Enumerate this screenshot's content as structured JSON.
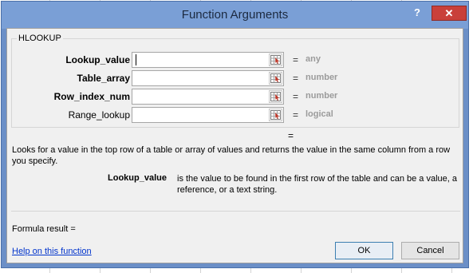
{
  "window": {
    "title": "Function Arguments",
    "help_glyph": "?",
    "close_glyph": "✕"
  },
  "function_name": "HLOOKUP",
  "arguments": [
    {
      "label": "Lookup_value",
      "value": "",
      "hint": "any",
      "bold": true
    },
    {
      "label": "Table_array",
      "value": "",
      "hint": "number",
      "bold": true
    },
    {
      "label": "Row_index_num",
      "value": "",
      "hint": "number",
      "bold": true
    },
    {
      "label": "Range_lookup",
      "value": "",
      "hint": "logical",
      "bold": false
    }
  ],
  "equals": "=",
  "result_equals": "=",
  "description": "Looks for a value in the top row of a table or array of values and returns the value in the same column from a row you specify.",
  "arg_help": {
    "name": "Lookup_value",
    "text": "is the value to be found in the first row of the table and can be a value, a reference, or a text string."
  },
  "formula_result": "Formula result =",
  "help_link": "Help on this function",
  "buttons": {
    "ok": "OK",
    "cancel": "Cancel"
  },
  "icons": {
    "ref": "range-selector-icon"
  }
}
